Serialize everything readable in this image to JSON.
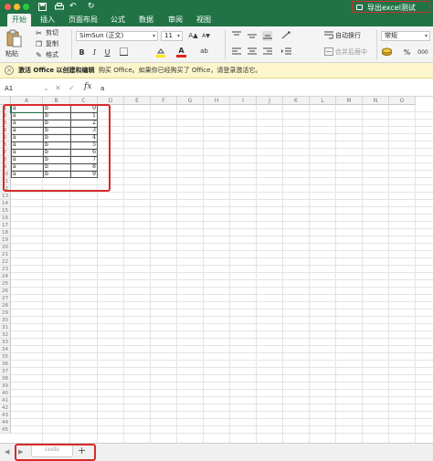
{
  "titlebar": {
    "quick_access": [
      "save-icon",
      "print-icon",
      "undo-icon",
      "redo-icon"
    ],
    "undo_glyph": "↶",
    "redo_glyph": "↻",
    "title": "导出excel测试"
  },
  "tabs": [
    "开始",
    "插入",
    "页面布局",
    "公式",
    "数据",
    "审阅",
    "视图"
  ],
  "ribbon": {
    "paste_label": "粘贴",
    "cut_label": "剪切",
    "copy_label": "复制",
    "format_painter_label": "格式",
    "font_name": "SimSun (正文)",
    "font_size": "11",
    "bold": "B",
    "italic": "I",
    "underline": "U",
    "wrap_text_label": "自动换行",
    "merge_center_label": "合并后居中",
    "number_format": "常规",
    "grow_font": "A▲",
    "shrink_font": "A▼",
    "font_color_glyph": "A",
    "abc_glyph": "ab",
    "percent": "%",
    "thousands": "000"
  },
  "message_bar": {
    "title": "激活 Office 以创建和编辑",
    "text": "购买 Office。如果你已经购买了 Office，请登录激活它。"
  },
  "formula_bar": {
    "cell_ref": "A1",
    "fx": "fx",
    "value": "a"
  },
  "grid": {
    "columns": [
      "A",
      "B",
      "C",
      "D",
      "E",
      "F",
      "G",
      "H",
      "I",
      "J",
      "K",
      "L",
      "M",
      "N",
      "O"
    ],
    "row_count": 45,
    "rows": [
      [
        "a",
        "b",
        "0"
      ],
      [
        "a",
        "b",
        "1"
      ],
      [
        "a",
        "b",
        "2"
      ],
      [
        "a",
        "b",
        "3"
      ],
      [
        "a",
        "b",
        "4"
      ],
      [
        "a",
        "b",
        "5"
      ],
      [
        "a",
        "b",
        "6"
      ],
      [
        "a",
        "b",
        "7"
      ],
      [
        "a",
        "b",
        "8"
      ],
      [
        "a",
        "b",
        "9"
      ]
    ]
  },
  "sheets": {
    "tabs": [
      "ceshi"
    ],
    "add_label": "+",
    "nav_prev": "◀",
    "nav_next": "▶"
  },
  "colors": {
    "accent": "#217346",
    "annotation": "#d62b2b",
    "message_bg": "#fdf6cc"
  }
}
